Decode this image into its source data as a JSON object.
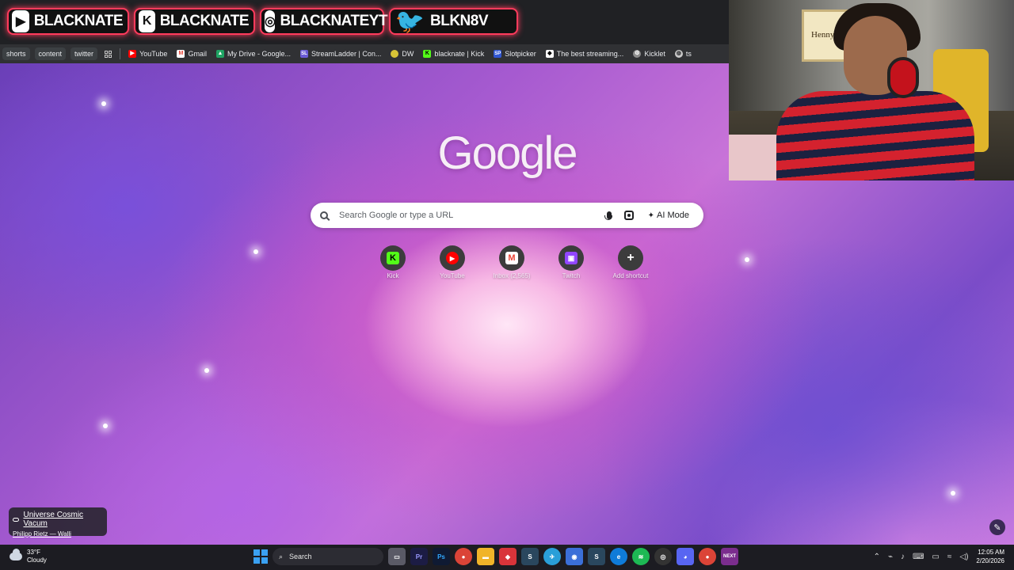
{
  "social": [
    {
      "platform": "youtube",
      "icon": "▶",
      "handle": "BLACKNATE"
    },
    {
      "platform": "kick",
      "icon": "K",
      "handle": "BLACKNATE"
    },
    {
      "platform": "instagram",
      "icon": "◎",
      "handle": "BLACKNATEYT"
    },
    {
      "platform": "twitter",
      "icon": "🐦",
      "handle": "BLKN8V"
    }
  ],
  "bookmarks": {
    "tags": [
      "shorts",
      "content",
      "twitter"
    ],
    "items": [
      {
        "label": "YouTube",
        "icon": "youtube-icon",
        "color": "#ff0000"
      },
      {
        "label": "Gmail",
        "icon": "gmail-icon",
        "color": "#ea4335"
      },
      {
        "label": "My Drive - Google...",
        "icon": "drive-icon",
        "color": "#1fa463"
      },
      {
        "label": "StreamLadder | Con...",
        "icon": "streamladder-icon",
        "color": "#6b5bd6"
      },
      {
        "label": "DW",
        "icon": "dw-icon",
        "color": "#d8c437"
      },
      {
        "label": "blacknate | Kick",
        "icon": "kick-icon",
        "color": "#53fc18"
      },
      {
        "label": "Slotpicker",
        "icon": "slotpicker-icon",
        "color": "#3056d3"
      },
      {
        "label": "The best streaming...",
        "icon": "diamond-icon",
        "color": "#ffffff"
      },
      {
        "label": "Kicklet",
        "icon": "kicklet-icon",
        "color": "#8d8d8d"
      },
      {
        "label": "ts",
        "icon": "globe-icon",
        "color": "#c8c8c8"
      }
    ]
  },
  "webcam": {
    "poster_text": "Hennything"
  },
  "google": {
    "logo": "Google",
    "search_placeholder": "Search Google or type a URL",
    "ai_mode_label": "AI Mode"
  },
  "shortcuts": [
    {
      "label": "Kick",
      "glyph": "K",
      "bg": "#53fc18",
      "fg": "#000000"
    },
    {
      "label": "YouTube",
      "glyph": "▶",
      "bg": "#ff0000",
      "fg": "#ffffff"
    },
    {
      "label": "Inbox (2,565)",
      "glyph": "M",
      "bg": "#ffffff",
      "fg": "#ea4335"
    },
    {
      "label": "Twitch",
      "glyph": "▣",
      "bg": "#9146ff",
      "fg": "#ffffff"
    },
    {
      "label": "Add shortcut",
      "glyph": "+",
      "bg": "transparent",
      "fg": "#ffffff"
    }
  ],
  "wallpaper_credit": {
    "title": "Universe Cosmic Vacum",
    "author": "Philipp Rietz — Walli"
  },
  "taskbar": {
    "temperature": "33°F",
    "condition": "Cloudy",
    "search_label": "Search",
    "time": "12:05 AM",
    "date": "2/20/2026"
  }
}
